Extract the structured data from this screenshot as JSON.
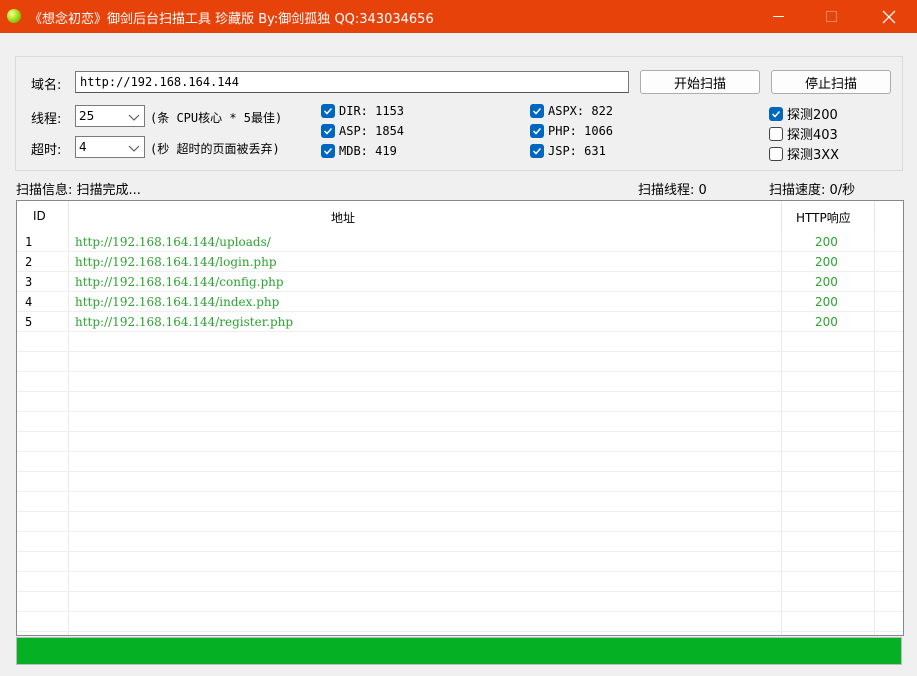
{
  "window": {
    "title": "《想念初恋》御剑后台扫描工具 珍藏版 By:御剑孤独 QQ:343034656",
    "accent_color": "#e8420b"
  },
  "form": {
    "domain_label": "域名:",
    "domain_value": "http://192.168.164.144",
    "start_button": "开始扫描",
    "stop_button": "停止扫描",
    "threads_label": "线程:",
    "threads_value": "25",
    "threads_hint": "(条 CPU核心 * 5最佳)",
    "timeout_label": "超时:",
    "timeout_value": "4",
    "timeout_hint": "(秒 超时的页面被丢弃)"
  },
  "dictionaries": [
    {
      "label": "DIR: 1153",
      "checked": true
    },
    {
      "label": "ASP: 1854",
      "checked": true
    },
    {
      "label": "MDB: 419",
      "checked": true
    },
    {
      "label": "ASPX: 822",
      "checked": true
    },
    {
      "label": "PHP: 1066",
      "checked": true
    },
    {
      "label": "JSP: 631",
      "checked": true
    }
  ],
  "probes": [
    {
      "label": "探测200",
      "checked": true
    },
    {
      "label": "探测403",
      "checked": false
    },
    {
      "label": "探测3XX",
      "checked": false
    }
  ],
  "status": {
    "info": "扫描信息: 扫描完成...",
    "threads": "扫描线程: 0",
    "speed": "扫描速度: 0/秒"
  },
  "results": {
    "columns": [
      "ID",
      "地址",
      "HTTP响应"
    ],
    "rows": [
      {
        "id": "1",
        "url": "http://192.168.164.144/uploads/",
        "code": "200"
      },
      {
        "id": "2",
        "url": "http://192.168.164.144/login.php",
        "code": "200"
      },
      {
        "id": "3",
        "url": "http://192.168.164.144/config.php",
        "code": "200"
      },
      {
        "id": "4",
        "url": "http://192.168.164.144/index.php",
        "code": "200"
      },
      {
        "id": "5",
        "url": "http://192.168.164.144/register.php",
        "code": "200"
      }
    ],
    "result_color": "#2aa330"
  },
  "progress": {
    "fraction": 1.0,
    "color": "#06b025"
  },
  "icons": {
    "app": "green-ball-icon",
    "minimize": "minimize-icon",
    "maximize": "maximize-icon",
    "close": "close-icon",
    "check": "checkmark-icon",
    "dropdown": "chevron-down-icon"
  }
}
